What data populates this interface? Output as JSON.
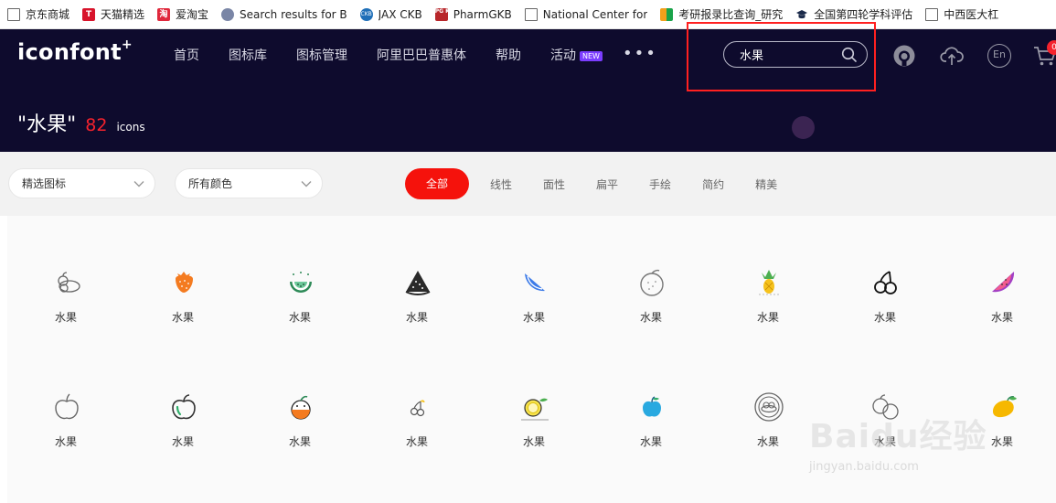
{
  "bookmarks": [
    {
      "label": "京东商城",
      "icon": "page-icon"
    },
    {
      "label": "天猫精选",
      "icon": "tmall-icon"
    },
    {
      "label": "爱淘宝",
      "icon": "taobao-icon"
    },
    {
      "label": "Search results for B",
      "icon": "search-results-icon"
    },
    {
      "label": "JAX CKB",
      "icon": "ckb-icon"
    },
    {
      "label": "PharmGKB",
      "icon": "pgkb-icon"
    },
    {
      "label": "National Center for",
      "icon": "page-icon"
    },
    {
      "label": "考研报录比查询_研究",
      "icon": "kaoyan-icon"
    },
    {
      "label": "全国第四轮学科评估",
      "icon": "graduation-cap-icon"
    },
    {
      "label": "中西医大杠",
      "icon": "page-icon"
    }
  ],
  "header": {
    "logo": "iconfont",
    "logo_mark": "+",
    "nav": [
      {
        "label": "首页"
      },
      {
        "label": "图标库"
      },
      {
        "label": "图标管理"
      },
      {
        "label": "阿里巴巴普惠体"
      },
      {
        "label": "帮助"
      },
      {
        "label": "活动",
        "badge": "NEW"
      }
    ],
    "more": "•••",
    "search": {
      "value": "水果"
    },
    "cart_count": "0",
    "lang": "En"
  },
  "results": {
    "query": "\"水果\"",
    "count": "82",
    "unit": "icons"
  },
  "filters": {
    "select_type": "精选图标",
    "select_color": "所有颜色",
    "tabs": [
      {
        "label": "全部",
        "active": true
      },
      {
        "label": "线性"
      },
      {
        "label": "面性"
      },
      {
        "label": "扁平"
      },
      {
        "label": "手绘"
      },
      {
        "label": "简约"
      },
      {
        "label": "精美"
      }
    ]
  },
  "icons": [
    {
      "name": "水果",
      "icon": "fruit-basket-icon"
    },
    {
      "name": "水果",
      "icon": "strawberry-icon"
    },
    {
      "name": "水果",
      "icon": "watermelon-bowl-icon"
    },
    {
      "name": "水果",
      "icon": "watermelon-slice-dark-icon"
    },
    {
      "name": "水果",
      "icon": "melon-slice-icon"
    },
    {
      "name": "水果",
      "icon": "orange-outline-icon"
    },
    {
      "name": "水果",
      "icon": "pineapple-icon"
    },
    {
      "name": "水果",
      "icon": "cherries-outline-icon"
    },
    {
      "name": "水果",
      "icon": "watermelon-slice-icon"
    },
    {
      "name": "水果",
      "icon": "apple-outline-icon"
    },
    {
      "name": "水果",
      "icon": "apple-green-icon"
    },
    {
      "name": "水果",
      "icon": "orange-slice-icon"
    },
    {
      "name": "水果",
      "icon": "cherries-small-icon"
    },
    {
      "name": "水果",
      "icon": "lemon-icon"
    },
    {
      "name": "水果",
      "icon": "apple-blue-icon"
    },
    {
      "name": "水果",
      "icon": "fruit-plate-icon"
    },
    {
      "name": "水果",
      "icon": "fruit-group-icon"
    },
    {
      "name": "水果",
      "icon": "mango-icon"
    }
  ],
  "watermark": {
    "text": "Baidu经验",
    "sub": "jingyan.baidu.com"
  },
  "colors": {
    "header_bg": "#0e0b2d",
    "accent": "#f5120c",
    "count_red": "#f5222d"
  }
}
